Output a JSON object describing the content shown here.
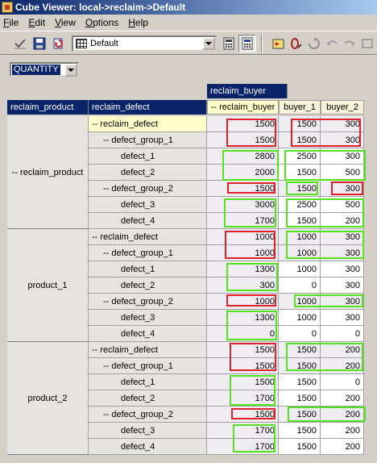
{
  "window": {
    "title": "Cube Viewer: local->reclaim->Default"
  },
  "menu": [
    {
      "label": "File",
      "u": "F",
      "rest": "ile"
    },
    {
      "label": "Edit",
      "u": "E",
      "rest": "dit"
    },
    {
      "label": "View",
      "u": "V",
      "rest": "iew"
    },
    {
      "label": "Options",
      "u": "O",
      "rest": "ptions"
    },
    {
      "label": "Help",
      "u": "H",
      "rest": "elp"
    }
  ],
  "toolbar": {
    "view_name": "Default"
  },
  "measure": {
    "selected": "QUANTITY"
  },
  "grid": {
    "column_dimension": "reclaim_buyer",
    "row_dimensions": [
      "reclaim_product",
      "reclaim_defect"
    ],
    "columns": [
      "-- reclaim_buyer",
      "buyer_1",
      "buyer_2"
    ],
    "groups": [
      "-- reclaim_product",
      "product_1",
      "product_2"
    ],
    "row_labels": [
      "-- reclaim_defect",
      "-- defect_group_1",
      "defect_1",
      "defect_2",
      "-- defect_group_2",
      "defect_3",
      "defect_4"
    ],
    "values": [
      [
        [
          "1500",
          "1500",
          "300"
        ],
        [
          "1500",
          "1500",
          "300"
        ],
        [
          "2800",
          "2500",
          "300"
        ],
        [
          "2000",
          "1500",
          "500"
        ],
        [
          "1500",
          "1500",
          "300"
        ],
        [
          "3000",
          "2500",
          "500"
        ],
        [
          "1700",
          "1500",
          "200"
        ]
      ],
      [
        [
          "1000",
          "1000",
          "300"
        ],
        [
          "1000",
          "1000",
          "300"
        ],
        [
          "1300",
          "1000",
          "300"
        ],
        [
          "300",
          "0",
          "300"
        ],
        [
          "1000",
          "1000",
          "300"
        ],
        [
          "1300",
          "1000",
          "300"
        ],
        [
          "0",
          "0",
          "0"
        ]
      ],
      [
        [
          "1500",
          "1500",
          "200"
        ],
        [
          "1500",
          "1500",
          "200"
        ],
        [
          "1500",
          "1500",
          "0"
        ],
        [
          "1700",
          "1500",
          "200"
        ],
        [
          "1500",
          "1500",
          "200"
        ],
        [
          "1700",
          "1500",
          "200"
        ],
        [
          "1700",
          "1500",
          "200"
        ]
      ]
    ]
  },
  "colors": {
    "highlight_red": "#e0202a",
    "highlight_green": "#52e31c",
    "header_blue": "#0a246a"
  }
}
